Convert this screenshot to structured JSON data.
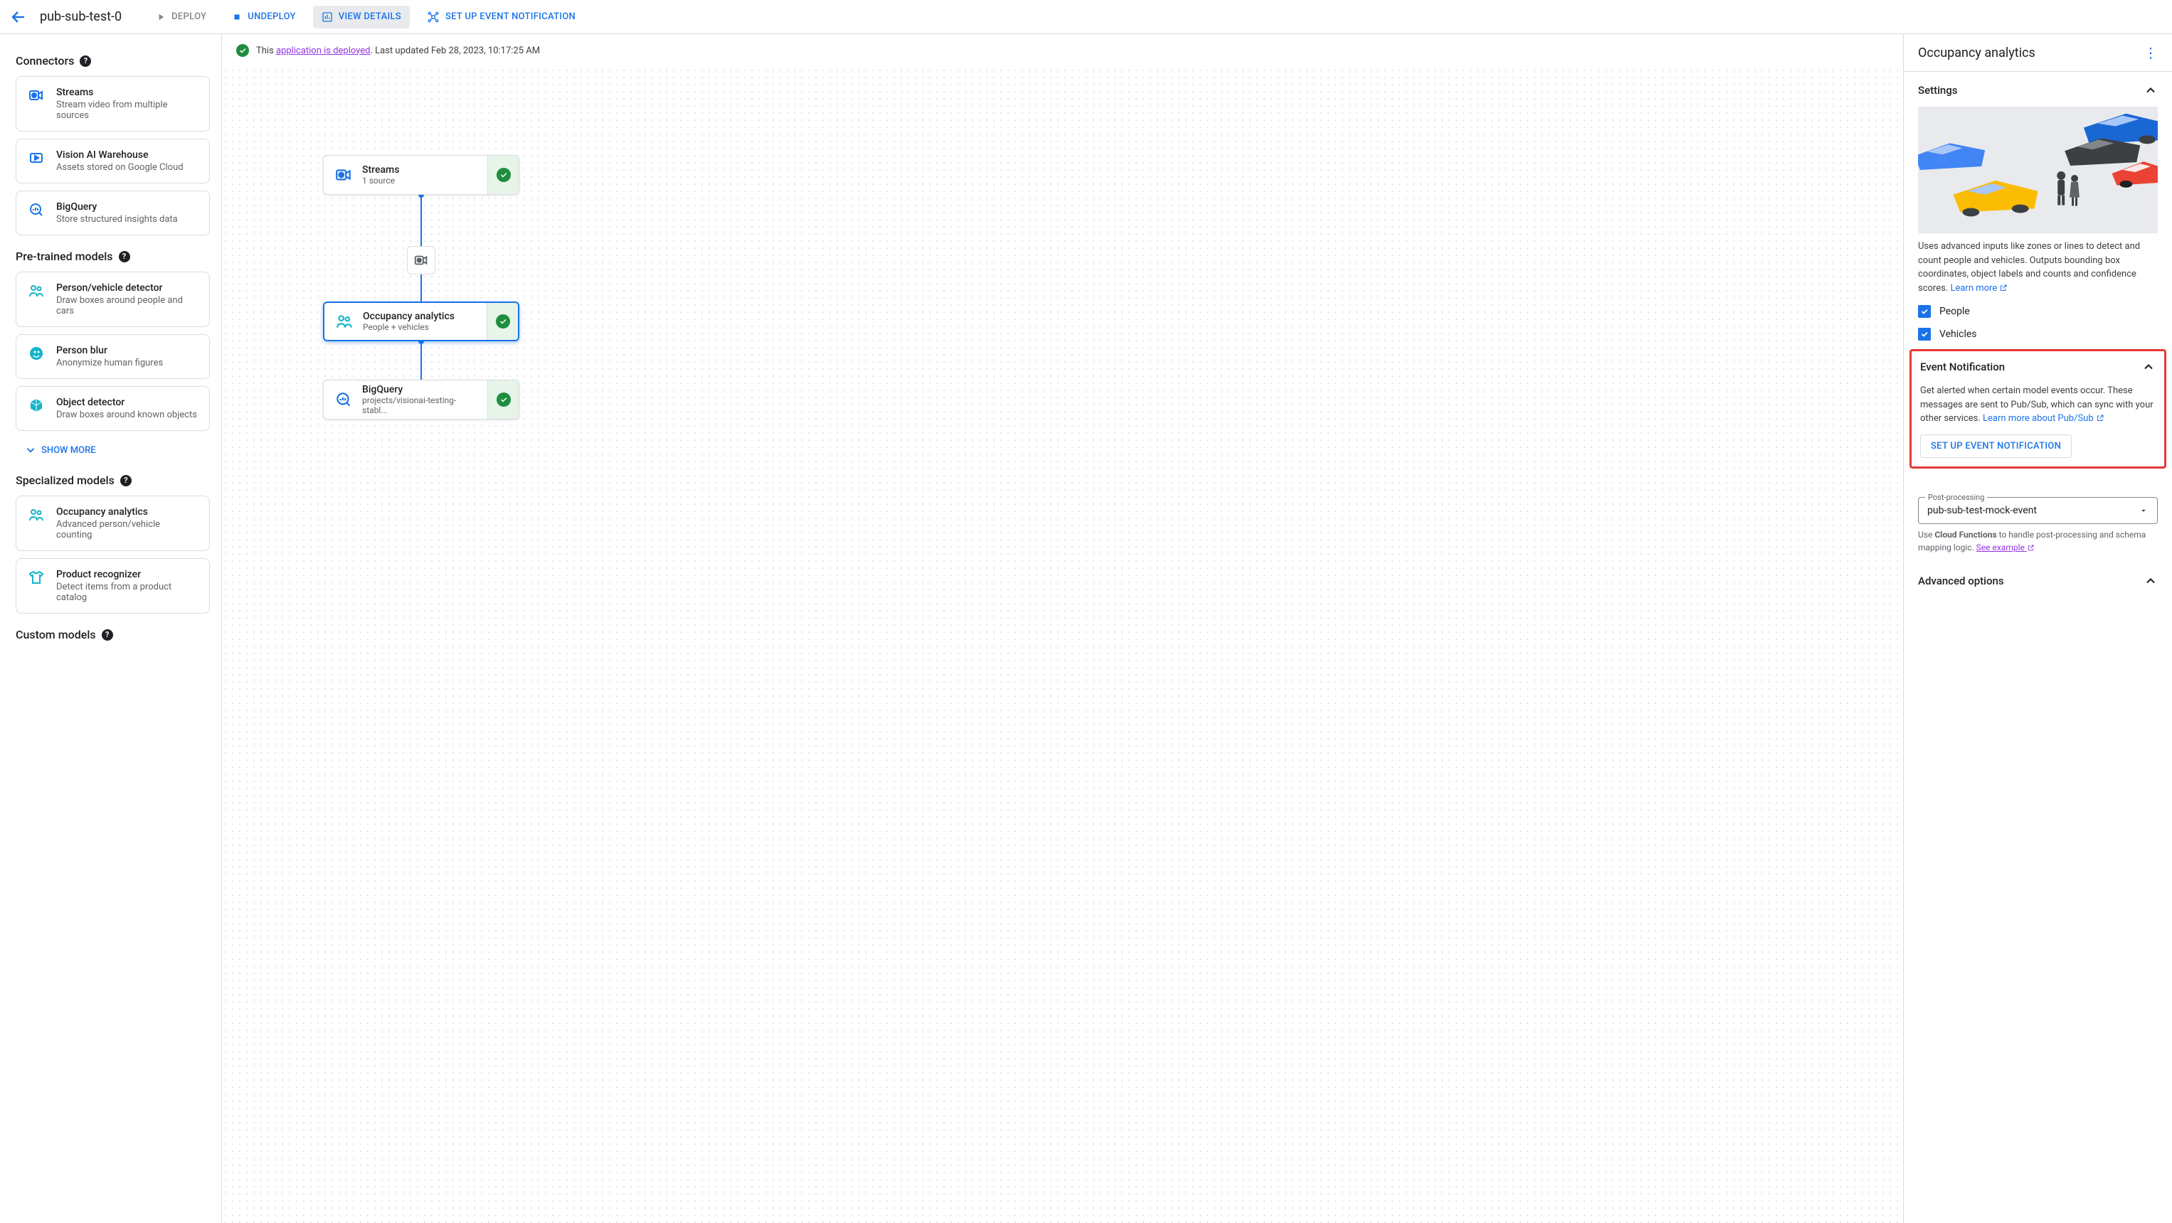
{
  "header": {
    "app_title": "pub-sub-test-0",
    "deploy": "DEPLOY",
    "undeploy": "UNDEPLOY",
    "view_details": "VIEW DETAILS",
    "set_up_event": "SET UP EVENT NOTIFICATION"
  },
  "status": {
    "prefix": "This ",
    "link": "application is deployed",
    "suffix": ". Last updated Feb 28, 2023, 10:17:25 AM"
  },
  "sidebar": {
    "connectors_heading": "Connectors",
    "pretrained_heading": "Pre-trained models",
    "specialized_heading": "Specialized models",
    "custom_heading": "Custom models",
    "show_more": "SHOW MORE",
    "connectors": [
      {
        "title": "Streams",
        "sub": "Stream video from multiple sources",
        "icon": "streams"
      },
      {
        "title": "Vision AI Warehouse",
        "sub": "Assets stored on Google Cloud",
        "icon": "warehouse"
      },
      {
        "title": "BigQuery",
        "sub": "Store structured insights data",
        "icon": "bigquery"
      }
    ],
    "pretrained": [
      {
        "title": "Person/vehicle detector",
        "sub": "Draw boxes around people and cars",
        "icon": "people"
      },
      {
        "title": "Person blur",
        "sub": "Anonymize human figures",
        "icon": "blur"
      },
      {
        "title": "Object detector",
        "sub": "Draw boxes around known objects",
        "icon": "object"
      }
    ],
    "specialized": [
      {
        "title": "Occupancy analytics",
        "sub": "Advanced person/vehicle counting",
        "icon": "people"
      },
      {
        "title": "Product recognizer",
        "sub": "Detect items from a product catalog",
        "icon": "shirt"
      }
    ]
  },
  "canvas": {
    "nodes": {
      "streams": {
        "title": "Streams",
        "sub": "1 source"
      },
      "occupancy": {
        "title": "Occupancy analytics",
        "sub": "People + vehicles"
      },
      "bigquery": {
        "title": "BigQuery",
        "sub": "projects/visionai-testing-stabl..."
      }
    }
  },
  "panel": {
    "title": "Occupancy analytics",
    "settings_heading": "Settings",
    "description": "Uses advanced inputs like zones or lines to detect and count people and vehicles. Outputs bounding box coordinates, object labels and counts and confidence scores. ",
    "learn_more": "Learn more",
    "cb_people": "People",
    "cb_vehicles": "Vehicles",
    "event_heading": "Event Notification",
    "event_desc": "Get alerted when certain model events occur. These messages are sent to Pub/Sub, which can sync with your other services. ",
    "event_link": "Learn more about Pub/Sub",
    "setup_btn": "SET UP EVENT NOTIFICATION",
    "postproc_label": "Post-processing",
    "postproc_value": "pub-sub-test-mock-event",
    "hint_prefix": "Use ",
    "hint_bold": "Cloud Functions",
    "hint_suffix": " to handle post-processing and schema mapping logic. ",
    "hint_link": "See example",
    "advanced_heading": "Advanced options"
  }
}
